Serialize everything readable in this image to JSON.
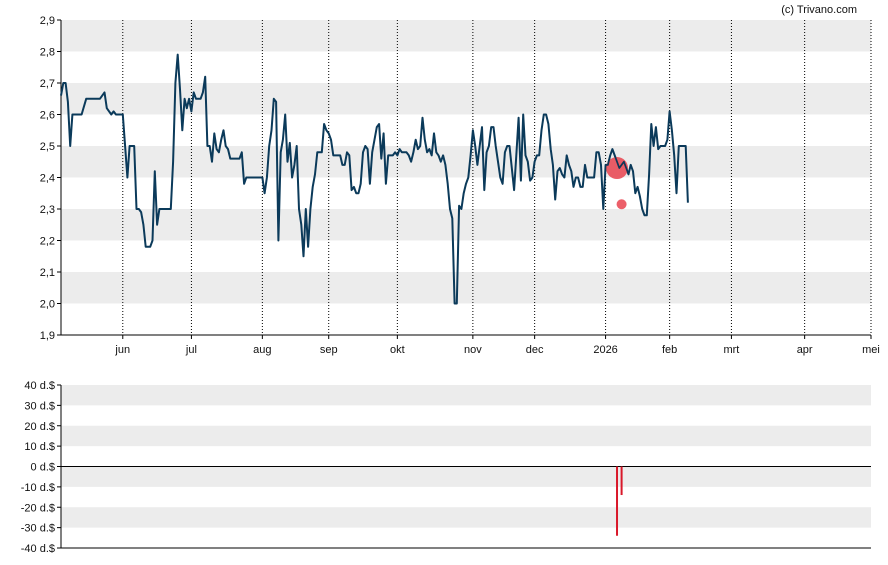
{
  "credit": "(c) Trivano.com",
  "colors": {
    "line": "#0b3a5a",
    "band": "#ececec",
    "marker": "#e9434f",
    "volume": "#d9182a",
    "axis": "#000000",
    "grid": "#000000"
  },
  "chart_data": [
    {
      "type": "line",
      "ylim": [
        1.9,
        2.9
      ],
      "y_ticks": [
        "1,9",
        "2,0",
        "2,1",
        "2,2",
        "2,3",
        "2,4",
        "2,5",
        "2,6",
        "2,7",
        "2,8",
        "2,9"
      ],
      "y_tick_values": [
        1.9,
        2.0,
        2.1,
        2.2,
        2.3,
        2.4,
        2.5,
        2.6,
        2.7,
        2.8,
        2.9
      ],
      "x_range_days": [
        0,
        354
      ],
      "x_ticks": [
        {
          "label": "jun",
          "day": 27
        },
        {
          "label": "jul",
          "day": 57
        },
        {
          "label": "aug",
          "day": 88
        },
        {
          "label": "sep",
          "day": 117
        },
        {
          "label": "okt",
          "day": 147
        },
        {
          "label": "nov",
          "day": 180
        },
        {
          "label": "dec",
          "day": 207
        },
        {
          "label": "2026",
          "day": 238
        },
        {
          "label": "feb",
          "day": 266
        },
        {
          "label": "mrt",
          "day": 293
        },
        {
          "label": "apr",
          "day": 325
        },
        {
          "label": "mei",
          "day": 354
        }
      ],
      "grid": true,
      "series": [
        {
          "points": [
            [
              0,
              2.66
            ],
            [
              1,
              2.7
            ],
            [
              2,
              2.7
            ],
            [
              3,
              2.64
            ],
            [
              4,
              2.5
            ],
            [
              5,
              2.6
            ],
            [
              6,
              2.6
            ],
            [
              8,
              2.6
            ],
            [
              9,
              2.6
            ],
            [
              11,
              2.65
            ],
            [
              13,
              2.65
            ],
            [
              15,
              2.65
            ],
            [
              17,
              2.65
            ],
            [
              19,
              2.67
            ],
            [
              20,
              2.62
            ],
            [
              22,
              2.6
            ],
            [
              23,
              2.61
            ],
            [
              24,
              2.6
            ],
            [
              25,
              2.6
            ],
            [
              26,
              2.6
            ],
            [
              27,
              2.6
            ],
            [
              29,
              2.4
            ],
            [
              30,
              2.5
            ],
            [
              32,
              2.5
            ],
            [
              33,
              2.3
            ],
            [
              34,
              2.3
            ],
            [
              35,
              2.29
            ],
            [
              36,
              2.25
            ],
            [
              37,
              2.18
            ],
            [
              39,
              2.18
            ],
            [
              40,
              2.2
            ],
            [
              41,
              2.42
            ],
            [
              42,
              2.25
            ],
            [
              43,
              2.3
            ],
            [
              44,
              2.3
            ],
            [
              46,
              2.3
            ],
            [
              48,
              2.3
            ],
            [
              49,
              2.45
            ],
            [
              50,
              2.7
            ],
            [
              51,
              2.79
            ],
            [
              52,
              2.68
            ],
            [
              53,
              2.55
            ],
            [
              54,
              2.65
            ],
            [
              55,
              2.62
            ],
            [
              56,
              2.65
            ],
            [
              57,
              2.61
            ],
            [
              58,
              2.67
            ],
            [
              59,
              2.65
            ],
            [
              61,
              2.65
            ],
            [
              62,
              2.67
            ],
            [
              63,
              2.72
            ],
            [
              64,
              2.5
            ],
            [
              65,
              2.5
            ],
            [
              66,
              2.45
            ],
            [
              67,
              2.54
            ],
            [
              68,
              2.49
            ],
            [
              69,
              2.48
            ],
            [
              70,
              2.52
            ],
            [
              71,
              2.55
            ],
            [
              72,
              2.5
            ],
            [
              73,
              2.49
            ],
            [
              74,
              2.46
            ],
            [
              76,
              2.46
            ],
            [
              78,
              2.46
            ],
            [
              79,
              2.48
            ],
            [
              80,
              2.38
            ],
            [
              81,
              2.4
            ],
            [
              83,
              2.4
            ],
            [
              85,
              2.4
            ],
            [
              87,
              2.4
            ],
            [
              88,
              2.4
            ],
            [
              89,
              2.35
            ],
            [
              90,
              2.4
            ],
            [
              91,
              2.5
            ],
            [
              92,
              2.55
            ],
            [
              93,
              2.65
            ],
            [
              94,
              2.64
            ],
            [
              95,
              2.2
            ],
            [
              96,
              2.48
            ],
            [
              97,
              2.52
            ],
            [
              98,
              2.6
            ],
            [
              99,
              2.45
            ],
            [
              100,
              2.51
            ],
            [
              101,
              2.4
            ],
            [
              102,
              2.44
            ],
            [
              103,
              2.5
            ],
            [
              104,
              2.3
            ],
            [
              105,
              2.25
            ],
            [
              106,
              2.15
            ],
            [
              107,
              2.3
            ],
            [
              108,
              2.18
            ],
            [
              109,
              2.3
            ],
            [
              110,
              2.37
            ],
            [
              111,
              2.41
            ],
            [
              112,
              2.48
            ],
            [
              114,
              2.48
            ],
            [
              115,
              2.57
            ],
            [
              116,
              2.55
            ],
            [
              117,
              2.54
            ],
            [
              118,
              2.52
            ],
            [
              119,
              2.47
            ],
            [
              121,
              2.47
            ],
            [
              122,
              2.47
            ],
            [
              123,
              2.44
            ],
            [
              124,
              2.44
            ],
            [
              125,
              2.48
            ],
            [
              126,
              2.47
            ],
            [
              127,
              2.36
            ],
            [
              128,
              2.37
            ],
            [
              129,
              2.35
            ],
            [
              130,
              2.35
            ],
            [
              131,
              2.38
            ],
            [
              132,
              2.48
            ],
            [
              133,
              2.5
            ],
            [
              134,
              2.49
            ],
            [
              135,
              2.38
            ],
            [
              136,
              2.48
            ],
            [
              137,
              2.52
            ],
            [
              138,
              2.56
            ],
            [
              139,
              2.57
            ],
            [
              140,
              2.46
            ],
            [
              141,
              2.54
            ],
            [
              142,
              2.38
            ],
            [
              143,
              2.47
            ],
            [
              145,
              2.47
            ],
            [
              146,
              2.48
            ],
            [
              147,
              2.47
            ],
            [
              148,
              2.49
            ],
            [
              149,
              2.48
            ],
            [
              150,
              2.48
            ],
            [
              151,
              2.48
            ],
            [
              152,
              2.47
            ],
            [
              153,
              2.45
            ],
            [
              154,
              2.48
            ],
            [
              155,
              2.52
            ],
            [
              156,
              2.49
            ],
            [
              157,
              2.5
            ],
            [
              158,
              2.59
            ],
            [
              159,
              2.52
            ],
            [
              160,
              2.48
            ],
            [
              161,
              2.49
            ],
            [
              162,
              2.47
            ],
            [
              163,
              2.54
            ],
            [
              164,
              2.48
            ],
            [
              165,
              2.47
            ],
            [
              166,
              2.45
            ],
            [
              167,
              2.47
            ],
            [
              168,
              2.44
            ],
            [
              169,
              2.38
            ],
            [
              170,
              2.3
            ],
            [
              171,
              2.27
            ],
            [
              172,
              2.0
            ],
            [
              173,
              2.0
            ],
            [
              174,
              2.31
            ],
            [
              175,
              2.3
            ],
            [
              176,
              2.35
            ],
            [
              177,
              2.38
            ],
            [
              178,
              2.4
            ],
            [
              179,
              2.47
            ],
            [
              180,
              2.55
            ],
            [
              181,
              2.5
            ],
            [
              182,
              2.44
            ],
            [
              183,
              2.5
            ],
            [
              184,
              2.56
            ],
            [
              185,
              2.36
            ],
            [
              186,
              2.48
            ],
            [
              187,
              2.5
            ],
            [
              188,
              2.56
            ],
            [
              189,
              2.56
            ],
            [
              190,
              2.5
            ],
            [
              191,
              2.45
            ],
            [
              192,
              2.4
            ],
            [
              193,
              2.38
            ],
            [
              194,
              2.48
            ],
            [
              195,
              2.5
            ],
            [
              196,
              2.5
            ],
            [
              197,
              2.43
            ],
            [
              198,
              2.36
            ],
            [
              199,
              2.47
            ],
            [
              200,
              2.59
            ],
            [
              201,
              2.39
            ],
            [
              202,
              2.6
            ],
            [
              203,
              2.47
            ],
            [
              204,
              2.45
            ],
            [
              205,
              2.39
            ],
            [
              206,
              2.4
            ],
            [
              207,
              2.45
            ],
            [
              208,
              2.47
            ],
            [
              209,
              2.47
            ],
            [
              210,
              2.55
            ],
            [
              211,
              2.6
            ],
            [
              212,
              2.6
            ],
            [
              213,
              2.57
            ],
            [
              214,
              2.49
            ],
            [
              215,
              2.44
            ],
            [
              216,
              2.33
            ],
            [
              217,
              2.42
            ],
            [
              218,
              2.43
            ],
            [
              219,
              2.41
            ],
            [
              220,
              2.4
            ],
            [
              221,
              2.47
            ],
            [
              222,
              2.44
            ],
            [
              223,
              2.42
            ],
            [
              224,
              2.37
            ],
            [
              225,
              2.4
            ],
            [
              226,
              2.4
            ],
            [
              227,
              2.37
            ],
            [
              228,
              2.37
            ],
            [
              229,
              2.44
            ],
            [
              230,
              2.4
            ],
            [
              231,
              2.4
            ],
            [
              233,
              2.4
            ],
            [
              234,
              2.48
            ],
            [
              235,
              2.48
            ],
            [
              236,
              2.44
            ],
            [
              237,
              2.3
            ],
            [
              238,
              2.44
            ],
            [
              239,
              2.44
            ],
            [
              240,
              2.47
            ],
            [
              241,
              2.49
            ],
            [
              242,
              2.47
            ],
            [
              243,
              2.45
            ],
            [
              244,
              2.43
            ],
            [
              245,
              2.44
            ],
            [
              246,
              2.45
            ],
            [
              247,
              2.43
            ],
            [
              248,
              2.41
            ],
            [
              249,
              2.44
            ],
            [
              250,
              2.42
            ],
            [
              251,
              2.35
            ],
            [
              252,
              2.37
            ],
            [
              253,
              2.34
            ],
            [
              254,
              2.3
            ],
            [
              255,
              2.28
            ],
            [
              256,
              2.28
            ],
            [
              257,
              2.41
            ],
            [
              258,
              2.57
            ],
            [
              259,
              2.5
            ],
            [
              260,
              2.56
            ],
            [
              261,
              2.49
            ],
            [
              262,
              2.5
            ],
            [
              263,
              2.5
            ],
            [
              264,
              2.5
            ],
            [
              265,
              2.52
            ],
            [
              266,
              2.61
            ],
            [
              267,
              2.55
            ],
            [
              268,
              2.47
            ],
            [
              269,
              2.35
            ],
            [
              270,
              2.5
            ],
            [
              271,
              2.5
            ],
            [
              272,
              2.5
            ],
            [
              273,
              2.5
            ],
            [
              274,
              2.32
            ]
          ]
        }
      ],
      "markers": [
        {
          "day": 243,
          "value": 2.43,
          "size": "large"
        },
        {
          "day": 245,
          "value": 2.315,
          "size": "small"
        }
      ]
    },
    {
      "type": "bar",
      "ylim": [
        -40,
        40
      ],
      "y_ticks": [
        "40 d.$",
        "30 d.$",
        "20 d.$",
        "10 d.$",
        "0 d.$",
        "-10 d.$",
        "-20 d.$",
        "-30 d.$",
        "-40 d.$"
      ],
      "y_tick_values": [
        40,
        30,
        20,
        10,
        0,
        -10,
        -20,
        -30,
        -40
      ],
      "bars": [
        {
          "day": 243,
          "value": -34
        },
        {
          "day": 245,
          "value": -14
        }
      ],
      "grid": true
    }
  ]
}
